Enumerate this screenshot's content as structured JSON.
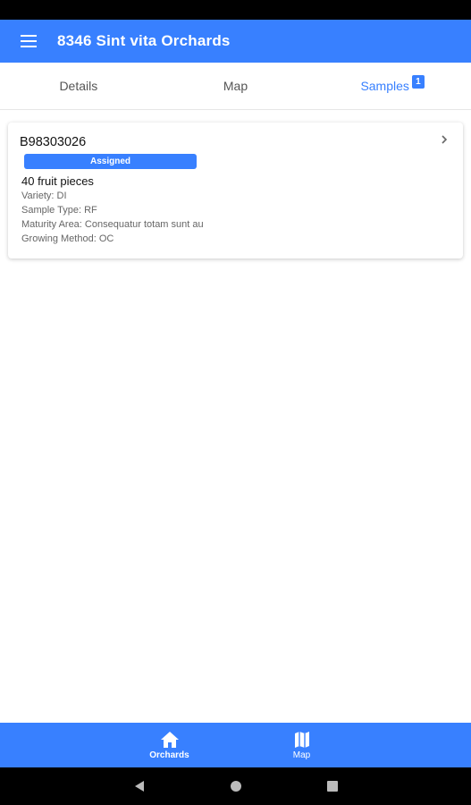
{
  "header": {
    "title": "8346 Sint vita Orchards",
    "menu_icon": "menu-icon"
  },
  "tabs": [
    {
      "label": "Details",
      "active": false
    },
    {
      "label": "Map",
      "active": false
    },
    {
      "label": "Samples",
      "active": true,
      "badge": "1"
    }
  ],
  "samples": [
    {
      "id": "B98303026",
      "status": "Assigned",
      "fruit_count": "40 fruit pieces",
      "variety": "Variety: DI",
      "sample_type": "Sample Type: RF",
      "maturity_area": "Maturity Area: Consequatur totam sunt au",
      "growing_method": "Growing Method: OC"
    }
  ],
  "bottom_nav": [
    {
      "label": "Orchards",
      "icon": "home-icon",
      "active": true
    },
    {
      "label": "Map",
      "icon": "map-icon",
      "active": false
    }
  ],
  "colors": {
    "primary": "#3880ff",
    "status_bar": "#000000",
    "nav_bar": "#000000"
  }
}
